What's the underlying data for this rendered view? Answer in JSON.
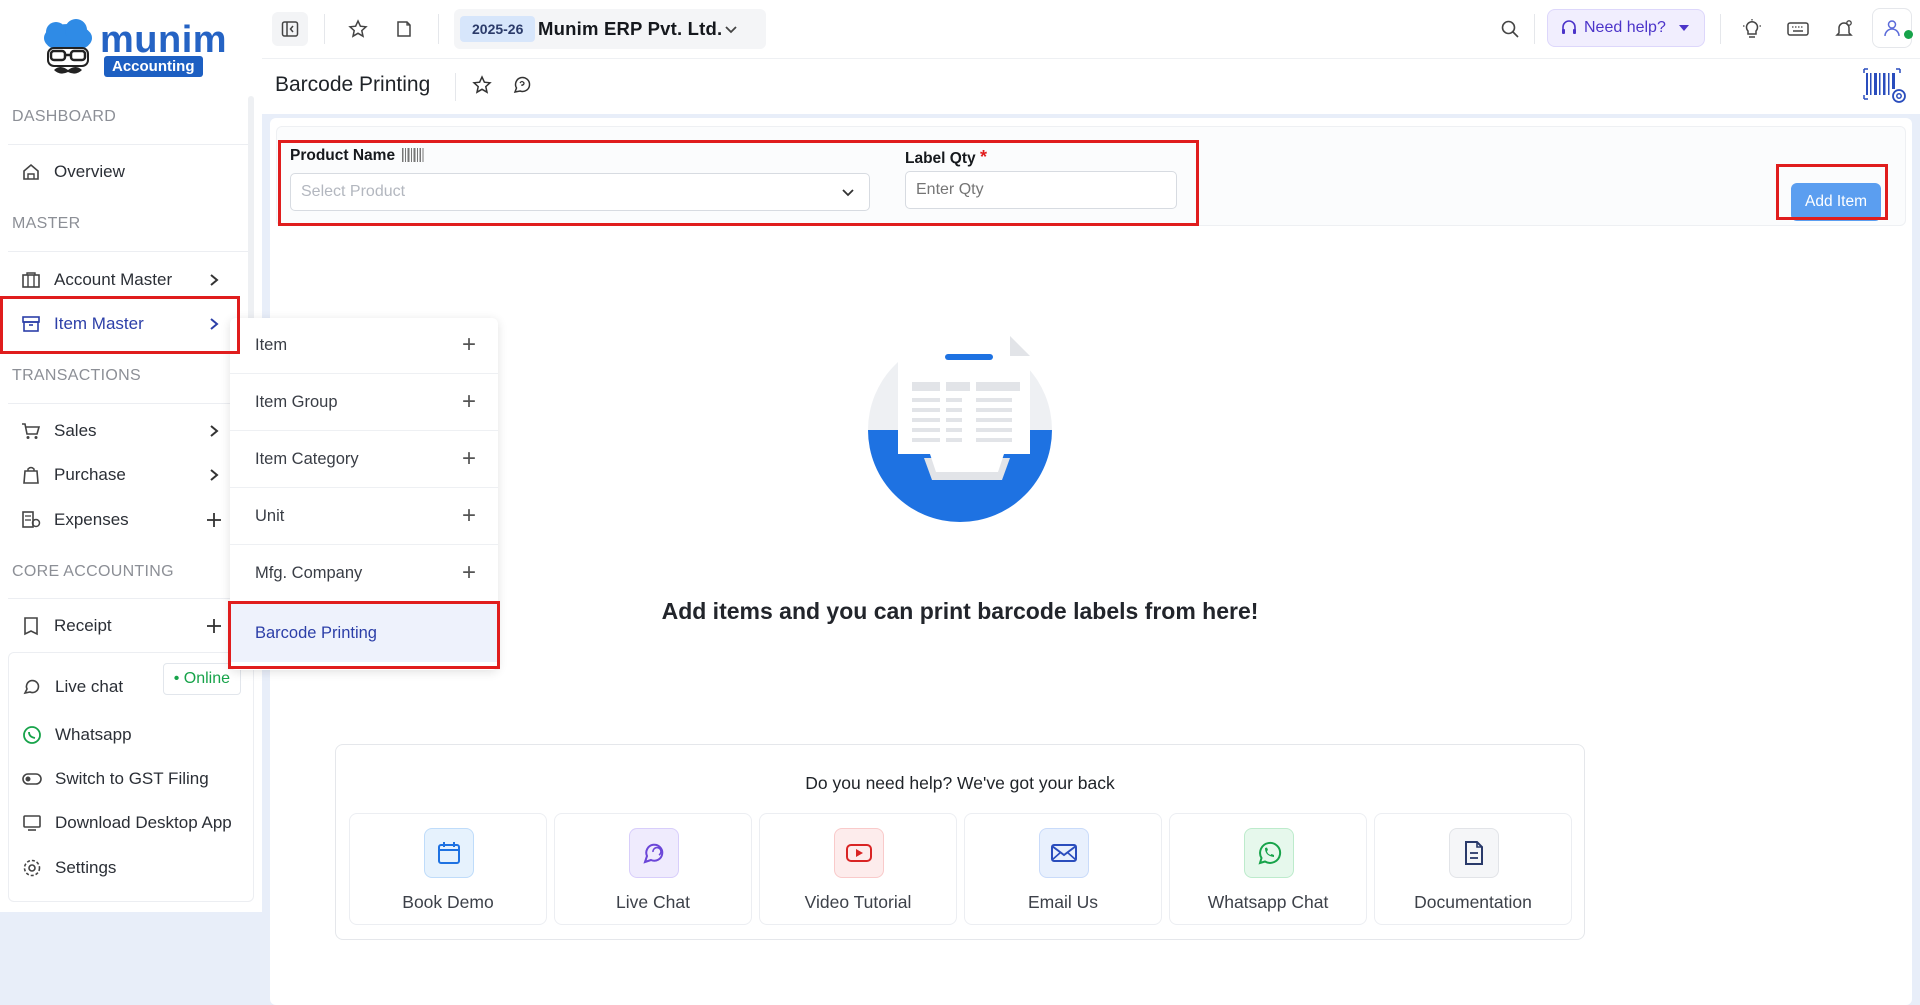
{
  "brand": {
    "name": "munim",
    "badge": "Accounting"
  },
  "sidebar": {
    "sections": {
      "dashboard": "DASHBOARD",
      "master": "MASTER",
      "transactions": "TRANSACTIONS",
      "core": "CORE ACCOUNTING"
    },
    "items": {
      "overview": "Overview",
      "account_master": "Account Master",
      "item_master": "Item Master",
      "sales": "Sales",
      "purchase": "Purchase",
      "expenses": "Expenses",
      "receipt": "Receipt"
    },
    "bottom": {
      "live_chat": "Live chat",
      "online": "• Online",
      "whatsapp": "Whatsapp",
      "gst": "Switch to GST Filing",
      "desktop": "Download Desktop App",
      "settings": "Settings"
    }
  },
  "flyout": {
    "items": [
      "Item",
      "Item Group",
      "Item Category",
      "Unit",
      "Mfg. Company",
      "Barcode Printing"
    ]
  },
  "topbar": {
    "fy": "2025-26",
    "company": "Munim ERP Pvt. Ltd.",
    "help": "Need help?"
  },
  "page": {
    "title": "Barcode Printing"
  },
  "form": {
    "product_label": "Product Name",
    "product_placeholder": "Select Product",
    "qty_label": "Label Qty",
    "qty_required": "*",
    "qty_placeholder": "Enter Qty",
    "add_button": "Add Item"
  },
  "empty": {
    "message": "Add items and you can print barcode labels from here!"
  },
  "help_panel": {
    "title": "Do you need help? We've got your back",
    "cards": [
      "Book Demo",
      "Live Chat",
      "Video Tutorial",
      "Email Us",
      "Whatsapp Chat",
      "Documentation"
    ]
  },
  "colors": {
    "accent": "#2563c4",
    "highlight": "#e01d1d",
    "online": "#17a34a"
  }
}
